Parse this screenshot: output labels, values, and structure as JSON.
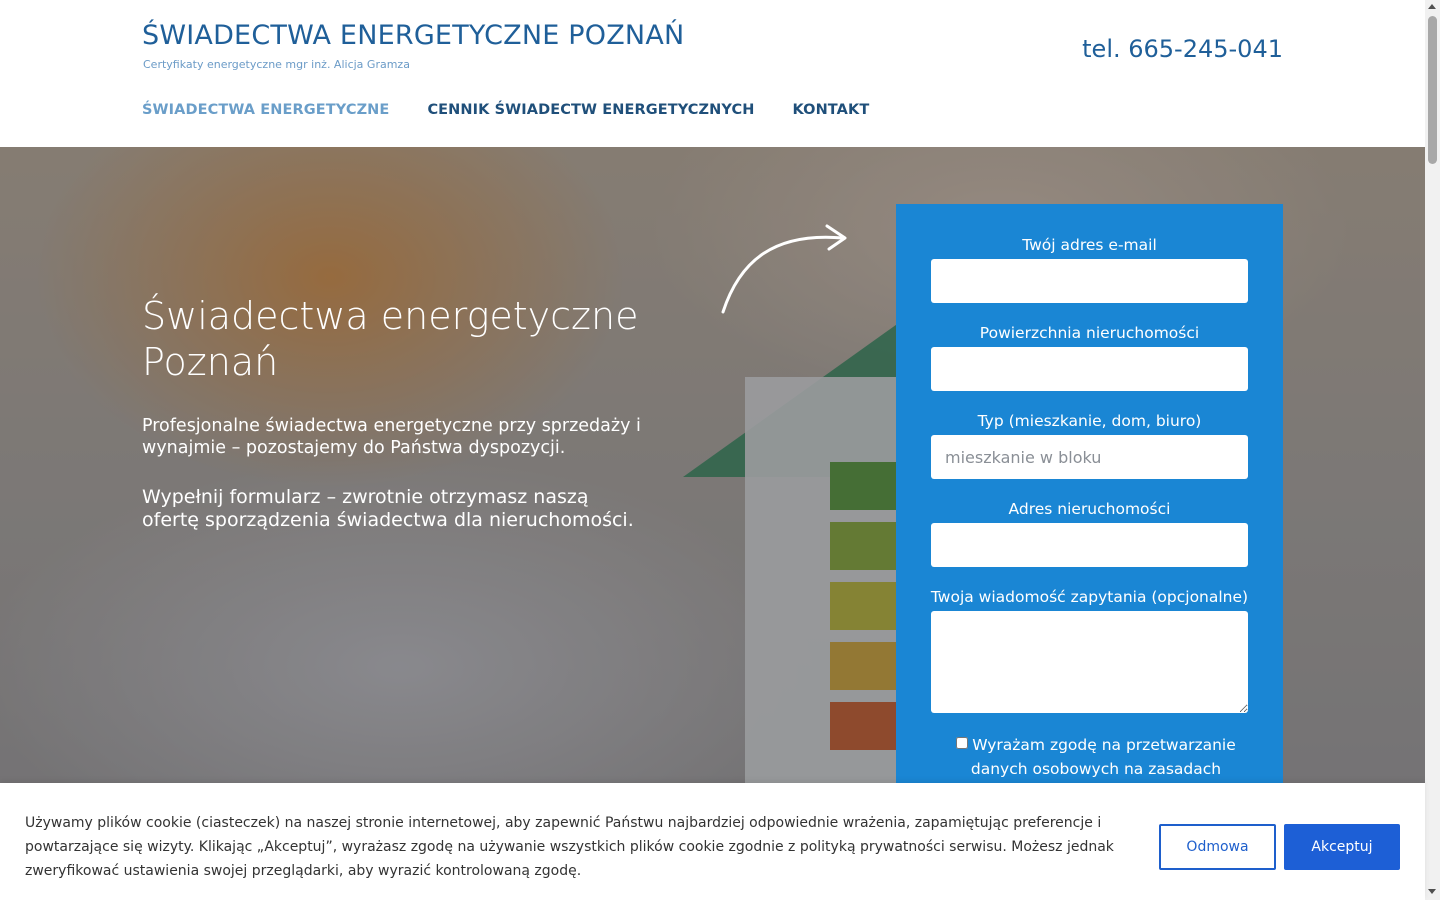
{
  "header": {
    "title": "ŚWIADECTWA ENERGETYCZNE POZNAŃ",
    "tagline": "Certyfikaty energetyczne mgr inż. Alicja Gramza",
    "phone": "tel. 665-245-041"
  },
  "nav": {
    "items": [
      {
        "label": "ŚWIADECTWA ENERGETYCZNE",
        "active": true
      },
      {
        "label": "CENNIK ŚWIADECTW ENERGETYCZNYCH",
        "active": false
      },
      {
        "label": "KONTAKT",
        "active": false
      }
    ]
  },
  "hero": {
    "title": "Świadectwa energetyczne Poznań",
    "paragraph1": "Profesjonalne świadectwa energetyczne przy sprzedaży i wynajmie – pozostajemy do Państwa dyspozycji.",
    "paragraph2": "Wypełnij formularz – zwrotnie otrzymasz naszą ofertę sporządzenia świadectwa dla nieruchomości."
  },
  "form": {
    "email_label": "Twój adres e-mail",
    "email_value": "",
    "area_label": "Powierzchnia nieruchomości",
    "area_value": "",
    "type_label": "Typ (mieszkanie, dom, biuro)",
    "type_placeholder": "mieszkanie w bloku",
    "address_label": "Adres nieruchomości",
    "address_value": "",
    "message_label": "Twoja wiadomość zapytania (opcjonalne)",
    "consent_text": "Wyrażam zgodę na przetwarzanie danych osobowych na zasadach"
  },
  "cookie": {
    "text": "Używamy plików cookie (ciasteczek) na naszej stronie internetowej, aby zapewnić Państwu najbardziej odpowiednie wrażenia, zapamiętując preferencje i powtarzające się wizyty. Klikając „Akceptuj”, wyrażasz zgodę na używanie wszystkich plików cookie zgodnie z polityką prywatności serwisu. Możesz jednak zweryfikować ustawienia swojej przeglądarki, aby wyrazić kontrolowaną zgodę.",
    "decline_label": "Odmowa",
    "accept_label": "Akceptuj"
  },
  "colors": {
    "brand_blue": "#1f5f99",
    "form_blue": "#1a86d4",
    "accept_blue": "#1d5fd6",
    "nav_active": "#6a9ec9"
  },
  "icons": {
    "hero_arrow": "curved-arrow-icon"
  }
}
